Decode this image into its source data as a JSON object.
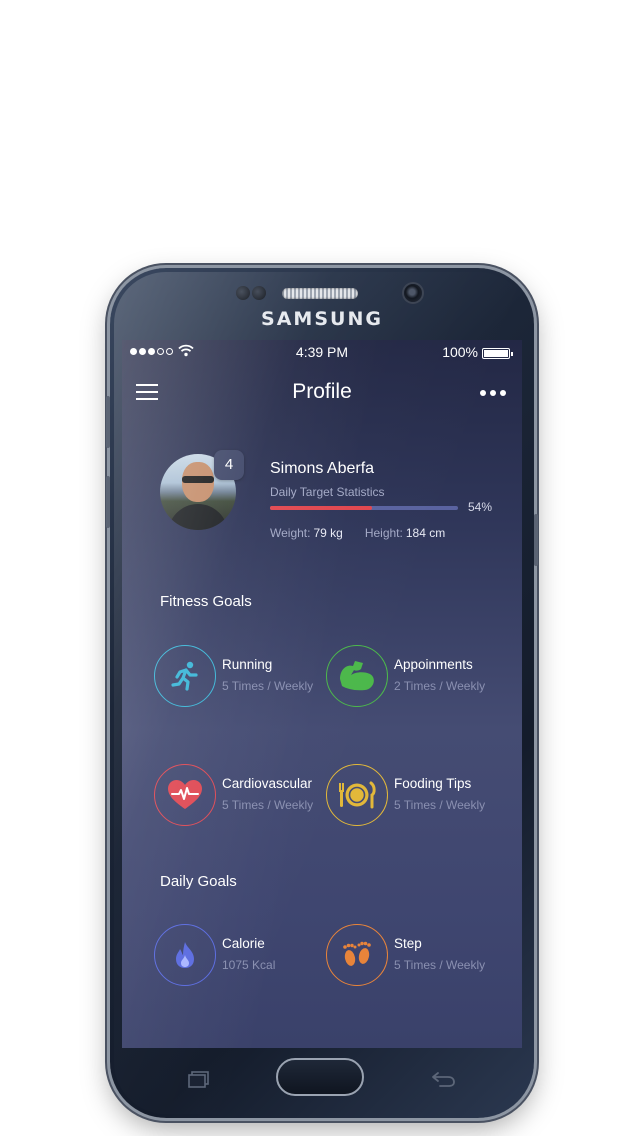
{
  "device": {
    "brand": "SAMSUNG"
  },
  "status_bar": {
    "time": "4:39 PM",
    "battery": "100%"
  },
  "nav": {
    "title": "Profile"
  },
  "profile": {
    "name": "Simons Aberfa",
    "level": "4",
    "target_label": "Daily Target Statistics",
    "progress_percent": 54,
    "progress_label": "54%",
    "weight_label": "Weight:",
    "weight_value": "79 kg",
    "height_label": "Height:",
    "height_value": "184 cm"
  },
  "fitness": {
    "title": "Fitness Goals",
    "items": [
      {
        "title": "Running",
        "subtitle": "5 Times / Weekly",
        "icon": "running-icon",
        "color": "#3cb7d8"
      },
      {
        "title": "Appoinments",
        "subtitle": "2 Times / Weekly",
        "icon": "muscle-arm-icon",
        "color": "#4cb84b"
      },
      {
        "title": "Cardiovascular",
        "subtitle": "5 Times / Weekly",
        "icon": "heartbeat-icon",
        "color": "#e04a55"
      },
      {
        "title": "Fooding Tips",
        "subtitle": "5 Times / Weekly",
        "icon": "plate-cutlery-icon",
        "color": "#e2b83a"
      }
    ]
  },
  "daily": {
    "title": "Daily Goals",
    "items": [
      {
        "title": "Calorie",
        "subtitle": "1075 Kcal",
        "icon": "flame-icon",
        "color": "#5a6be0"
      },
      {
        "title": "Step",
        "subtitle": "5 Times / Weekly",
        "icon": "footprints-icon",
        "color": "#e8843a"
      }
    ]
  }
}
